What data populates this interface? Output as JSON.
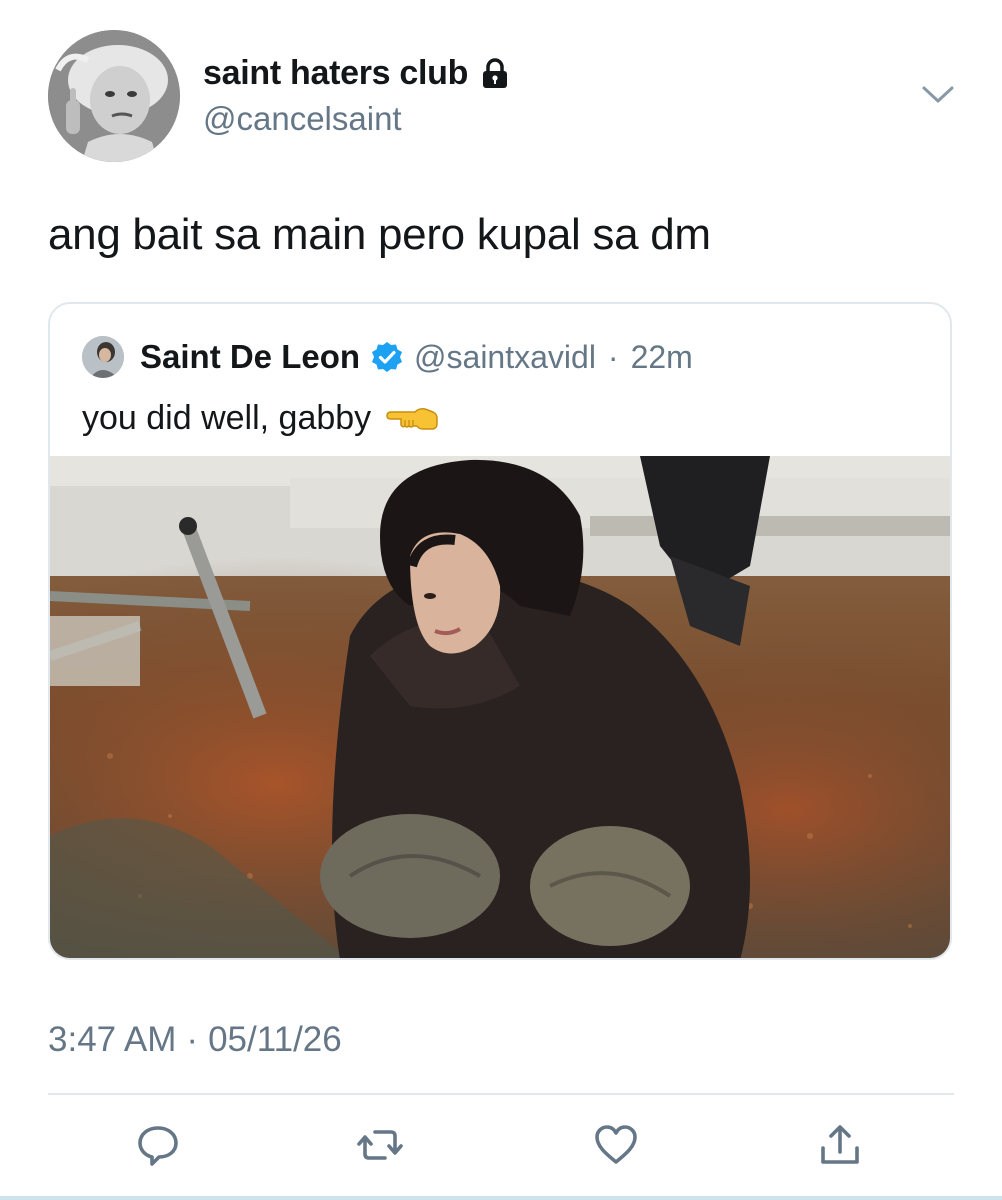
{
  "tweet": {
    "display_name": "saint haters club",
    "handle": "@cancelsaint",
    "text": "ang bait sa main pero kupal sa dm",
    "time": "3:47 AM",
    "separator": "·",
    "date": "05/11/26",
    "icons": {
      "lock": "lock-icon",
      "chevron": "chevron-down-icon",
      "reply": "reply-icon",
      "retweet": "retweet-icon",
      "like": "heart-icon",
      "share": "share-icon"
    }
  },
  "quoted": {
    "display_name": "Saint De Leon",
    "handle": "@saintxavidl",
    "separator": "·",
    "time": "22m",
    "text": "you did well, gabby",
    "icons": {
      "verified": "verified-badge-icon",
      "emoji": "backhand-index-pointing-left-icon"
    }
  },
  "colors": {
    "text_primary": "#14171a",
    "text_secondary": "#657786",
    "border": "#e1e8ed",
    "verified_blue": "#1da1f2",
    "icon_gray": "#657786"
  }
}
